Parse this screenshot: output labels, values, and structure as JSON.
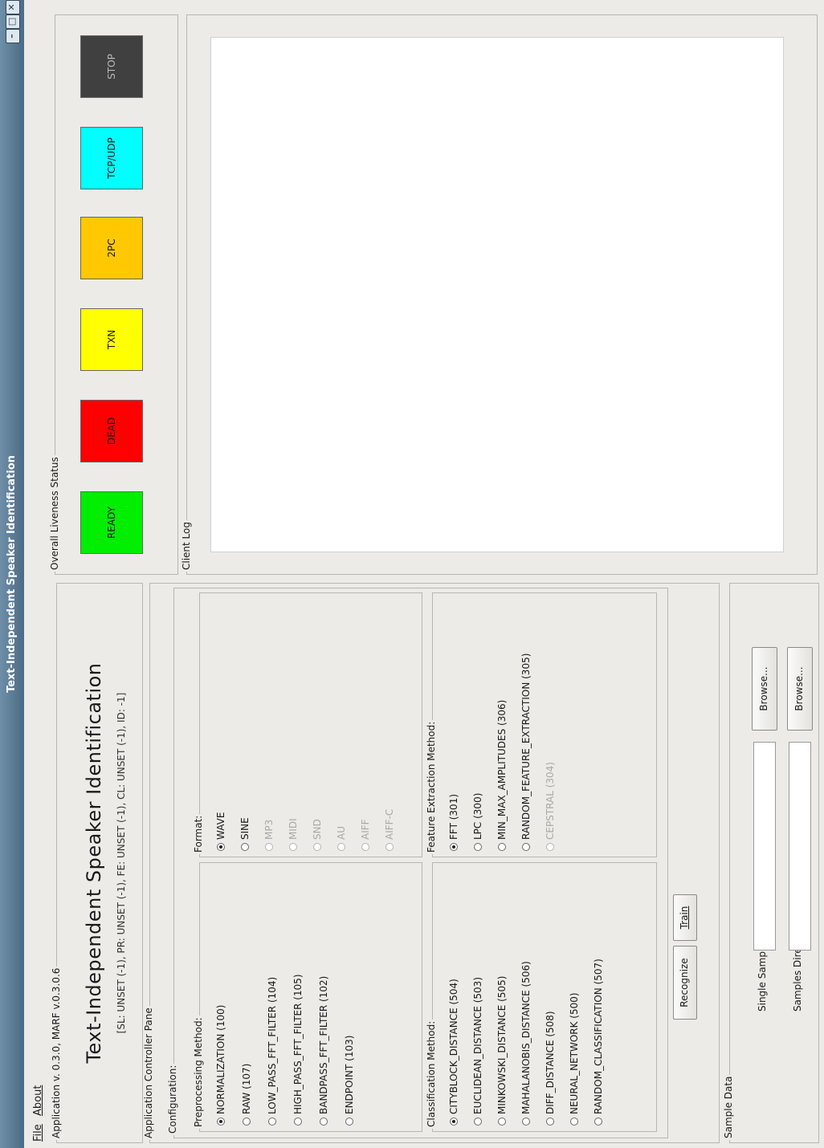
{
  "window": {
    "title": "Text-Independent Speaker Identification"
  },
  "menu": {
    "file": "File",
    "about": "About"
  },
  "app_group": {
    "label": "Application v. 0.3.0, MARF v.0.3.0.6",
    "heading": "Text-Independent Speaker Identification",
    "status_line": "[SL: UNSET (-1), PR: UNSET (-1), FE: UNSET (-1), CL: UNSET (-1), ID: -1]"
  },
  "controller": {
    "label": "Application Controller Pane",
    "configuration_label": "Configuration:",
    "format": {
      "label": "Format:",
      "options": [
        {
          "label": "WAVE",
          "selected": true,
          "enabled": true
        },
        {
          "label": "SINE",
          "selected": false,
          "enabled": true
        },
        {
          "label": "MP3",
          "selected": false,
          "enabled": false
        },
        {
          "label": "MIDI",
          "selected": false,
          "enabled": false
        },
        {
          "label": "SND",
          "selected": false,
          "enabled": false
        },
        {
          "label": "AU",
          "selected": false,
          "enabled": false
        },
        {
          "label": "AIFF",
          "selected": false,
          "enabled": false
        },
        {
          "label": "AIFF-C",
          "selected": false,
          "enabled": false
        }
      ]
    },
    "preprocessing": {
      "label": "Preprocessing Method:",
      "options": [
        {
          "label": "NORMALIZATION (100)",
          "selected": true,
          "enabled": true
        },
        {
          "label": "RAW (107)",
          "selected": false,
          "enabled": true
        },
        {
          "label": "LOW_PASS_FFT_FILTER (104)",
          "selected": false,
          "enabled": true
        },
        {
          "label": "HIGH_PASS_FFT_FILTER (105)",
          "selected": false,
          "enabled": true
        },
        {
          "label": "BANDPASS_FFT_FILTER (102)",
          "selected": false,
          "enabled": true
        },
        {
          "label": "ENDPOINT (103)",
          "selected": false,
          "enabled": true
        }
      ]
    },
    "feature_extraction": {
      "label": "Feature Extraction Method:",
      "options": [
        {
          "label": "FFT (301)",
          "selected": true,
          "enabled": true
        },
        {
          "label": "LPC (300)",
          "selected": false,
          "enabled": true
        },
        {
          "label": "MIN_MAX_AMPLITUDES (306)",
          "selected": false,
          "enabled": true
        },
        {
          "label": "RANDOM_FEATURE_EXTRACTION (305)",
          "selected": false,
          "enabled": true
        },
        {
          "label": "CEPSTRAL (304)",
          "selected": false,
          "enabled": false
        }
      ]
    },
    "classification": {
      "label": "Classification Method:",
      "options": [
        {
          "label": "CITYBLOCK_DISTANCE (504)",
          "selected": true,
          "enabled": true
        },
        {
          "label": "EUCLIDEAN_DISTANCE (503)",
          "selected": false,
          "enabled": true
        },
        {
          "label": "MINKOWSKI_DISTANCE (505)",
          "selected": false,
          "enabled": true
        },
        {
          "label": "MAHALANOBIS_DISTANCE (506)",
          "selected": false,
          "enabled": true
        },
        {
          "label": "DIFF_DISTANCE (508)",
          "selected": false,
          "enabled": true
        },
        {
          "label": "NEURAL_NETWORK (500)",
          "selected": false,
          "enabled": true
        },
        {
          "label": "RANDOM_CLASSIFICATION (507)",
          "selected": false,
          "enabled": true
        }
      ]
    },
    "train_button": "Train",
    "recognize_button": "Recognize"
  },
  "sample_data": {
    "label": "Sample Data",
    "single_file_label": "Single Sample File:",
    "single_file_value": "",
    "directory_label": "Samples Directory:",
    "directory_value": "",
    "browse_label": "Browse..."
  },
  "liveness": {
    "label": "Overall Liveness Status",
    "indicators": [
      {
        "label": "READY",
        "color": "#00ee00"
      },
      {
        "label": "DEAD",
        "color": "#ff0000"
      },
      {
        "label": "TXN",
        "color": "#ffff00"
      },
      {
        "label": "2PC",
        "color": "#ffc800"
      },
      {
        "label": "TCP/UDP",
        "color": "#00ffff"
      },
      {
        "label": "STOP",
        "color": "#404040"
      }
    ]
  },
  "client_log": {
    "label": "Client Log",
    "text": ""
  }
}
